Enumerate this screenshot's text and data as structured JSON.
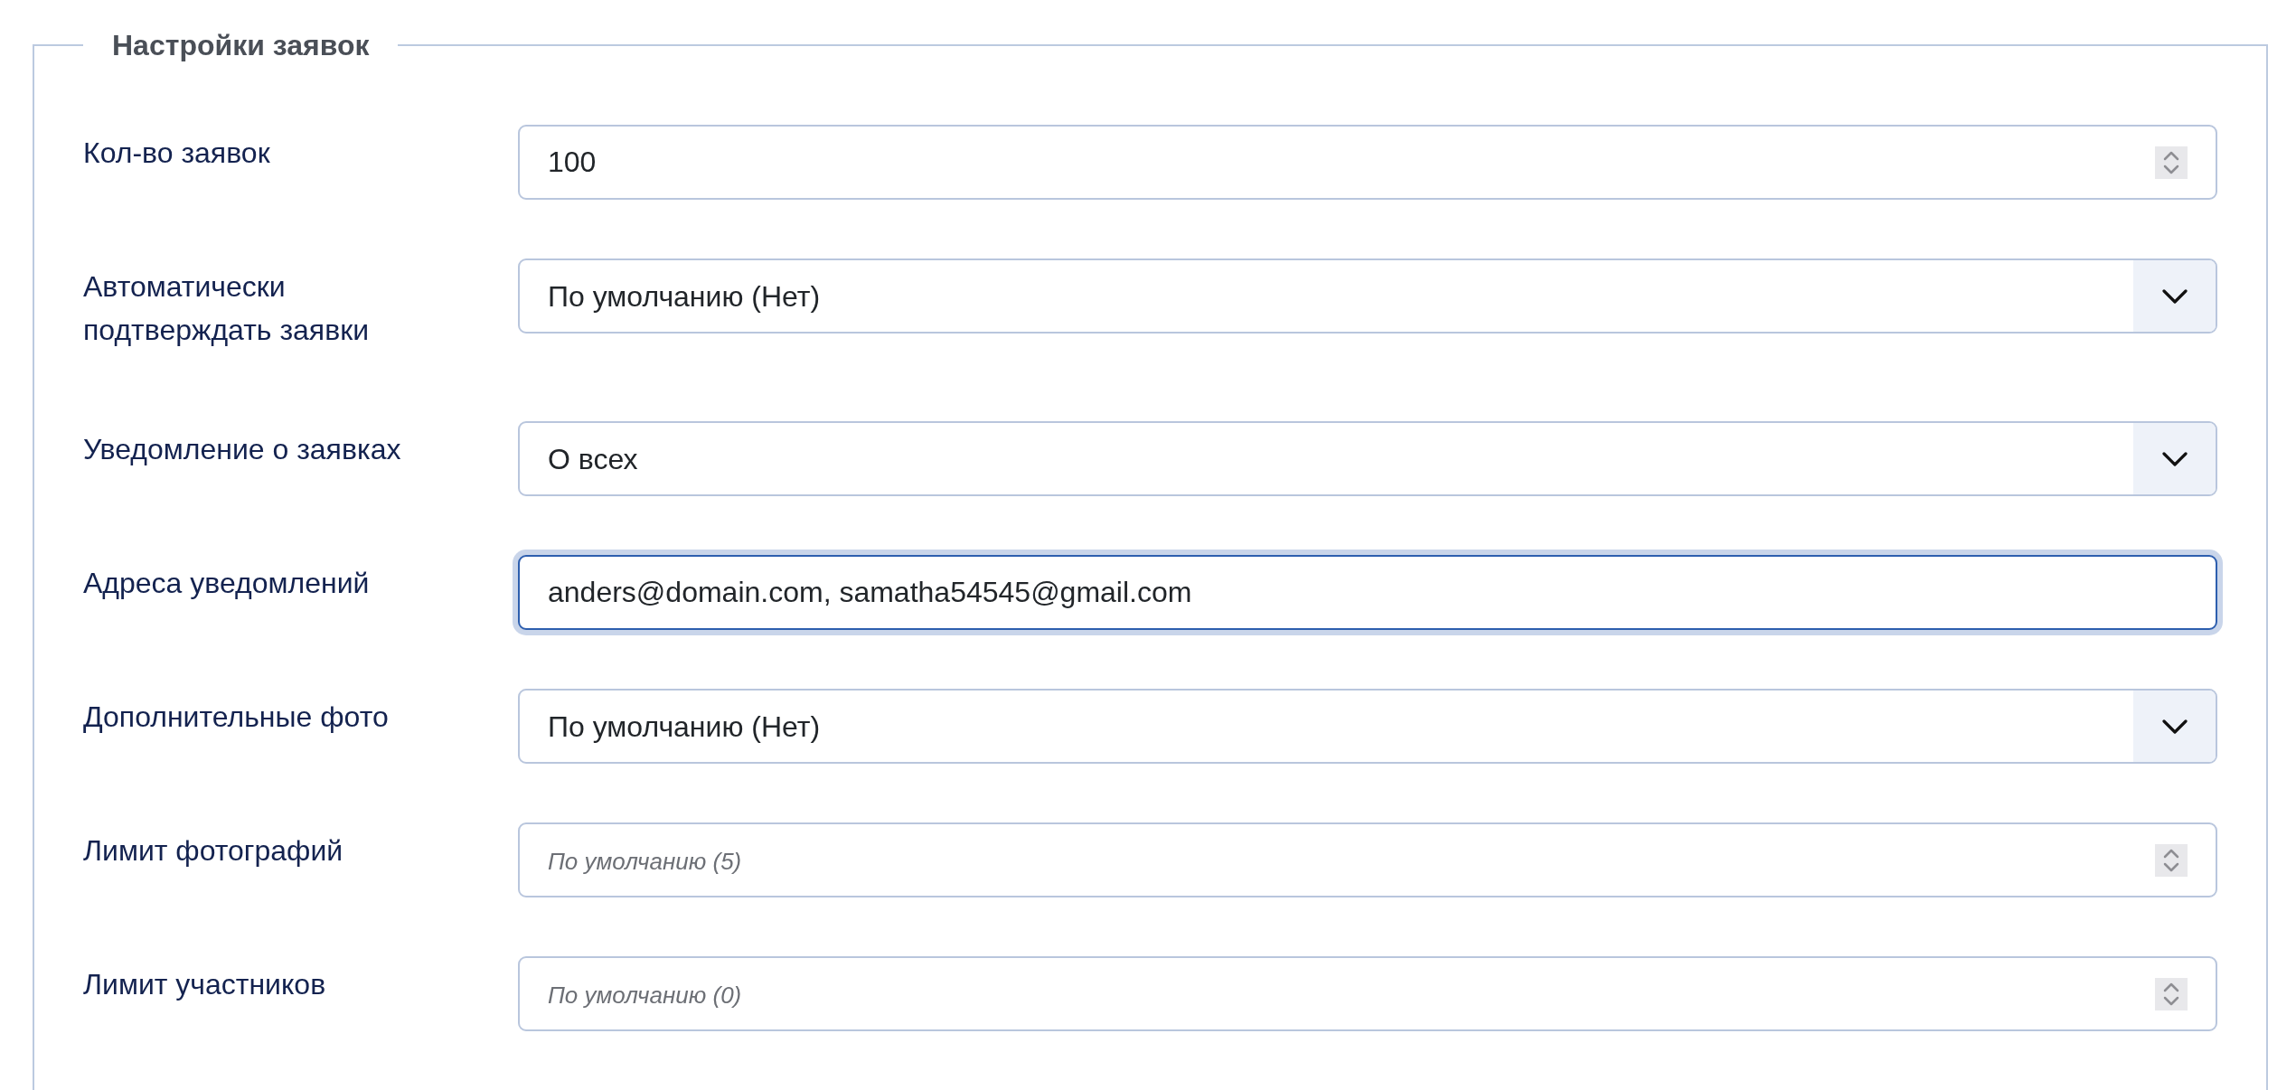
{
  "fieldset": {
    "legend": "Настройки заявок"
  },
  "rows": [
    {
      "label": "Кол-во заявок",
      "kind": "number",
      "value": "100",
      "focused": false
    },
    {
      "label": "Автоматически подтверждать заявки",
      "kind": "select",
      "value": "По умолчанию (Нет)",
      "focused": false
    },
    {
      "label": "Уведомление о заявках",
      "kind": "select",
      "value": "О всех",
      "focused": false
    },
    {
      "label": "Адреса уведомлений",
      "kind": "text",
      "value": "anders@domain.com, samatha54545@gmail.com",
      "focused": true
    },
    {
      "label": "Дополнительные фото",
      "kind": "select",
      "value": "По умолчанию (Нет)",
      "focused": false
    },
    {
      "label": "Лимит фотографий",
      "kind": "number",
      "placeholder": "По умолчанию (5)",
      "focused": false
    },
    {
      "label": "Лимит участников",
      "kind": "number",
      "placeholder": "По умолчанию (0)",
      "focused": false
    }
  ]
}
